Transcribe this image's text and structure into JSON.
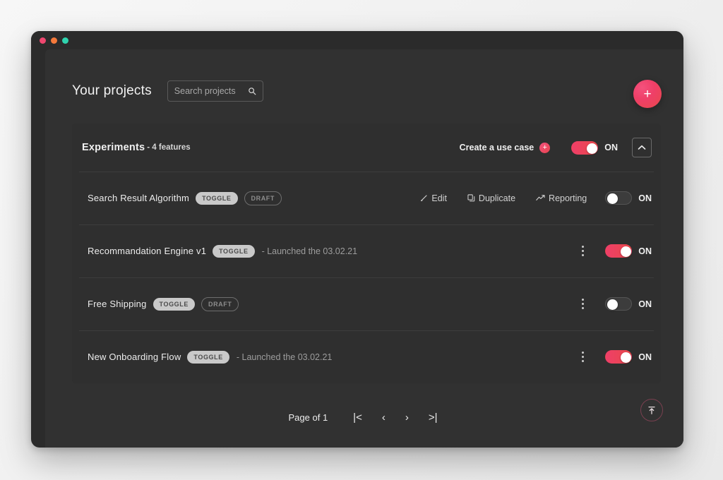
{
  "window": {
    "traffic_lights": [
      "close",
      "minimize",
      "maximize"
    ]
  },
  "header": {
    "title": "Your projects",
    "search": {
      "value": "",
      "placeholder": "Search projects"
    },
    "add_button_label": "+"
  },
  "card": {
    "title": "Experiments",
    "subtitle": "- 4 features",
    "create_use_case_label": "Create a use case",
    "create_use_case_icon": "+",
    "toggle": {
      "state": "on",
      "label": "ON"
    },
    "collapse_label": "collapse"
  },
  "features": [
    {
      "name": "Search Result Algorithm",
      "badges": [
        "TOGGLE",
        "DRAFT"
      ],
      "meta": "",
      "actions": [
        {
          "label": "Edit",
          "icon": "pencil-icon"
        },
        {
          "label": "Duplicate",
          "icon": "copy-icon"
        },
        {
          "label": "Reporting",
          "icon": "chart-icon"
        }
      ],
      "toggle": {
        "state": "off",
        "label": "ON"
      }
    },
    {
      "name": "Recommandation Engine v1",
      "badges": [
        "TOGGLE"
      ],
      "meta": "- Launched the 03.02.21",
      "actions": [],
      "toggle": {
        "state": "on",
        "label": "ON"
      }
    },
    {
      "name": "Free Shipping",
      "badges": [
        "TOGGLE",
        "DRAFT"
      ],
      "meta": "",
      "actions": [],
      "toggle": {
        "state": "off",
        "label": "ON"
      }
    },
    {
      "name": "New Onboarding Flow",
      "badges": [
        "TOGGLE"
      ],
      "meta": "- Launched the 03.02.21",
      "actions": [],
      "toggle": {
        "state": "on",
        "label": "ON"
      }
    }
  ],
  "pagination": {
    "label": "Page of 1",
    "first": "|<",
    "prev": "‹",
    "next": "›",
    "last": ">|"
  },
  "colors": {
    "accent_start": "#ef3f68",
    "accent_end": "#e8484b",
    "window_bg": "#2b2b2b",
    "content_bg": "#313131",
    "card_bg": "#2f2f2f",
    "divider": "#3d3d3d"
  }
}
